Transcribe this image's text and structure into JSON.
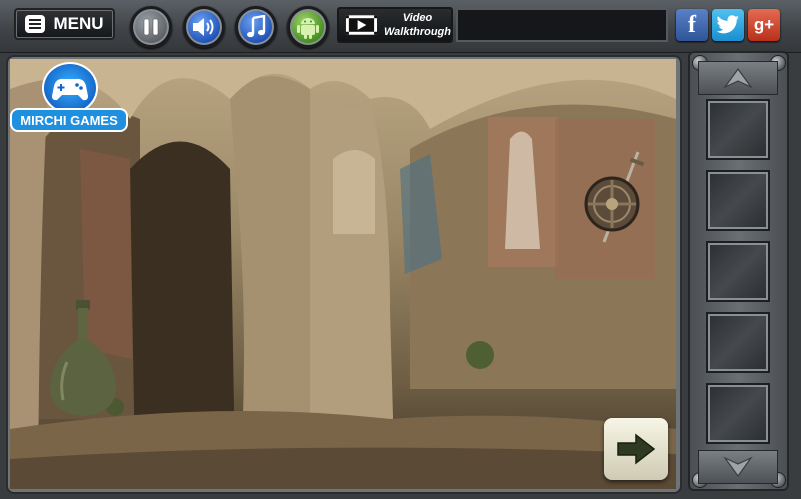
{
  "topbar": {
    "menu_label": "MENU",
    "video_line1": "Video",
    "video_line2": "Walkthrough",
    "buttons": [
      "pause-icon",
      "speaker-icon",
      "music-note-icon",
      "android-icon"
    ],
    "social": {
      "facebook": "f",
      "google_plus": "g+"
    }
  },
  "logo": {
    "text": "MIRCHI GAMES"
  },
  "scene": {
    "items": [
      "bottle",
      "shield-with-sword"
    ]
  },
  "inventory": {
    "slot_count": 5,
    "up_arrow": "chevron-up-icon",
    "down_arrow": "chevron-down-icon"
  },
  "colors": {
    "bar": "#3f4347",
    "accent_blue": "#1f8fe0",
    "facebook": "#2f5598",
    "twitter": "#1b8fd0",
    "google_plus": "#b8301a"
  }
}
